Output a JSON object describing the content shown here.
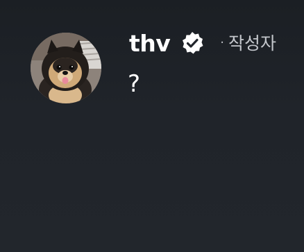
{
  "comment": {
    "author": {
      "name": "thv",
      "verified_icon": "verified-badge-icon",
      "separator": "·",
      "tag": "작성자"
    },
    "avatar_icon": "dog-avatar",
    "text": "?"
  },
  "colors": {
    "background": "#20242a",
    "text": "#ffffff",
    "muted": "#c4c7cc"
  }
}
